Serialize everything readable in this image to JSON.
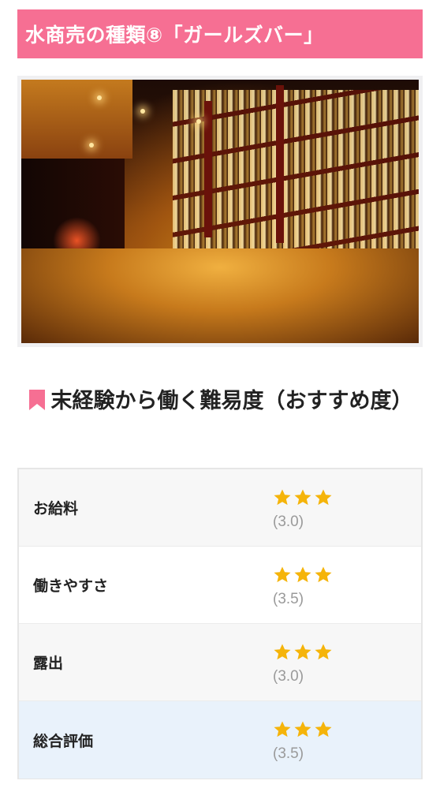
{
  "header": {
    "title": "水商売の種類⑧「ガールズバー」"
  },
  "colors": {
    "accent": "#f66f93",
    "star": "#f5b40a",
    "highlight_row": "#e9f2fb"
  },
  "section": {
    "icon": "bookmark-icon",
    "heading": "末経験から働く難易度（おすすめ度）"
  },
  "ratings": [
    {
      "label": "お給料",
      "stars": 3,
      "score": "(3.0)"
    },
    {
      "label": "働きやすさ",
      "stars": 3,
      "score": "(3.5)"
    },
    {
      "label": "露出",
      "stars": 3,
      "score": "(3.0)"
    },
    {
      "label": "総合評価",
      "stars": 3,
      "score": "(3.5)"
    }
  ]
}
